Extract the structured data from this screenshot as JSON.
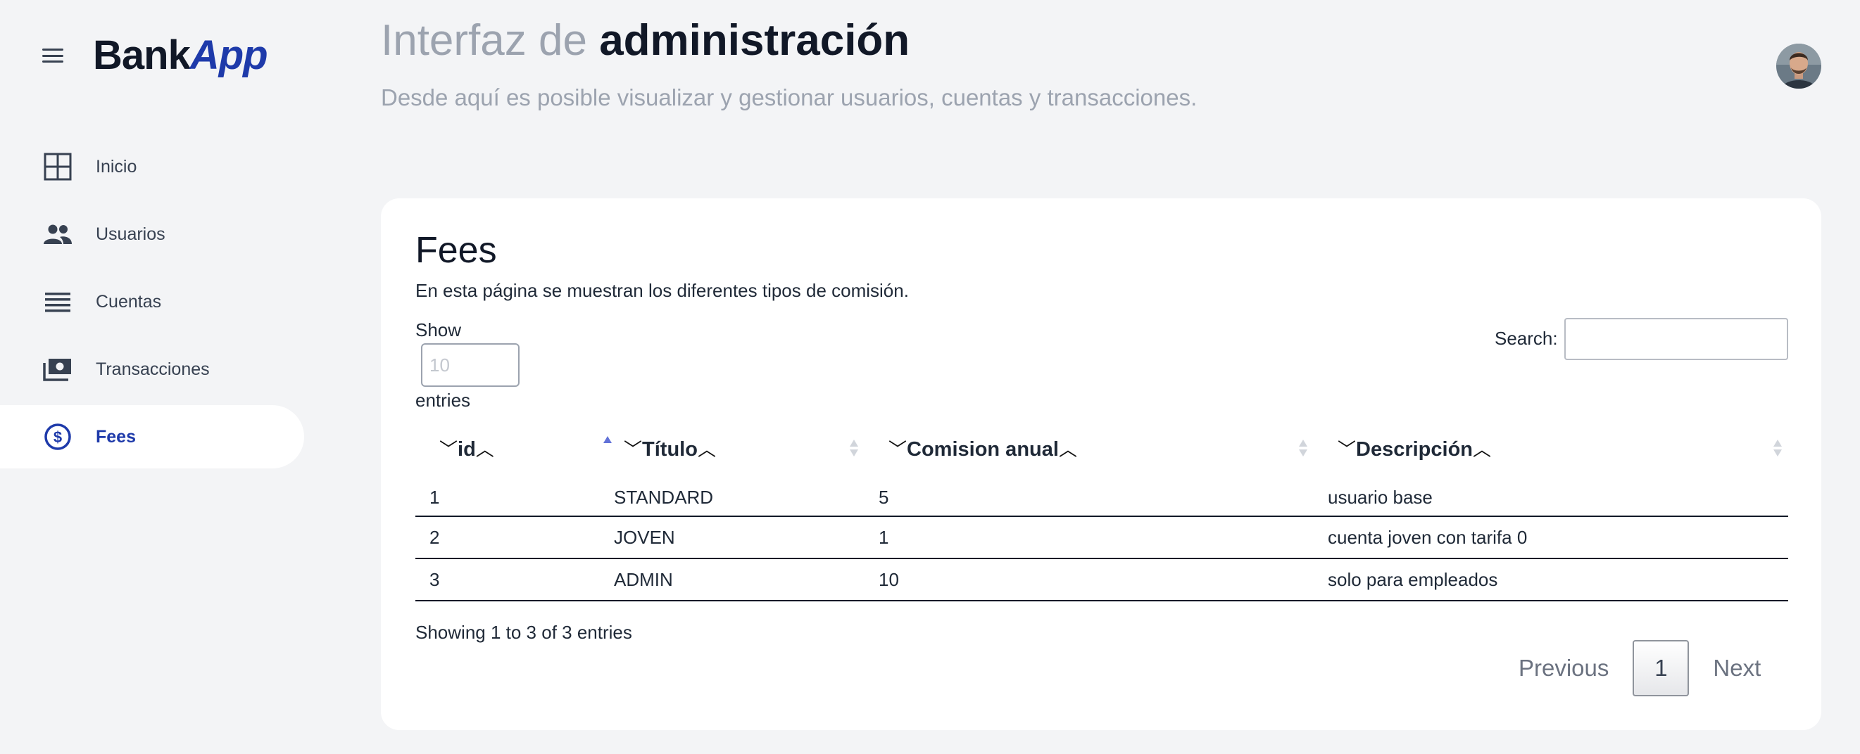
{
  "brand": {
    "name_part1": "Bank",
    "name_part2": "App"
  },
  "sidebar": {
    "items": [
      {
        "label": "Inicio",
        "icon": "grid-icon",
        "active": false
      },
      {
        "label": "Usuarios",
        "icon": "users-icon",
        "active": false
      },
      {
        "label": "Cuentas",
        "icon": "list-icon",
        "active": false
      },
      {
        "label": "Transacciones",
        "icon": "cash-icon",
        "active": false
      },
      {
        "label": "Fees",
        "icon": "dollar-circle-icon",
        "active": true
      }
    ]
  },
  "header": {
    "title_light": "Interfaz de ",
    "title_bold": "administración",
    "subtitle": "Desde aquí es posible visualizar y gestionar usuarios, cuentas y transacciones."
  },
  "card": {
    "title": "Fees",
    "description": "En esta página se muestran los diferentes tipos de comisión.",
    "length": {
      "show_label": "Show",
      "placeholder": "10",
      "entries_label": "entries"
    },
    "search": {
      "label": "Search:",
      "value": ""
    },
    "table": {
      "columns": [
        "id",
        "Título",
        "Comision anual",
        "Descripción"
      ],
      "sorted_column": "id",
      "sort_direction": "asc",
      "rows": [
        [
          "1",
          "STANDARD",
          "5",
          "usuario base"
        ],
        [
          "2",
          "JOVEN",
          "1",
          "cuenta joven con tarifa 0"
        ],
        [
          "3",
          "ADMIN",
          "10",
          "solo para empleados"
        ]
      ]
    },
    "info": "Showing 1 to 3 of 3 entries",
    "pagination": {
      "previous": "Previous",
      "current": "1",
      "next": "Next"
    }
  },
  "colors": {
    "accent": "#1e3aaa",
    "background": "#f3f4f6",
    "card": "#ffffff",
    "muted_text": "#9ca3af",
    "sort_active": "#6272d8",
    "sort_inactive": "#d1d5db"
  }
}
